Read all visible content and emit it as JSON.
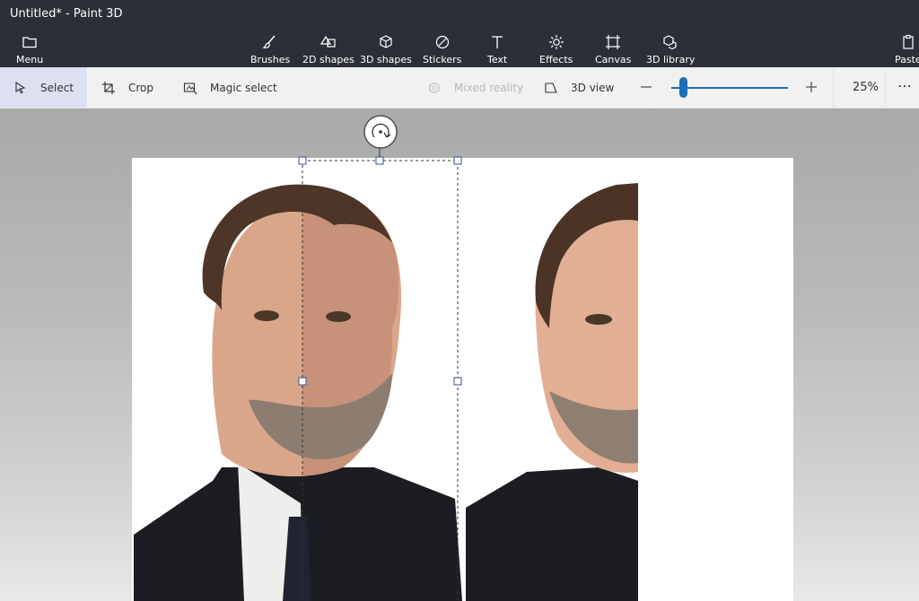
{
  "window": {
    "title": "Untitled* - Paint 3D"
  },
  "toolbar": {
    "menu": "Menu",
    "brushes": "Brushes",
    "shapes2d": "2D shapes",
    "shapes3d": "3D shapes",
    "stickers": "Stickers",
    "text": "Text",
    "effects": "Effects",
    "canvas": "Canvas",
    "library3d": "3D library",
    "paste": "Paste"
  },
  "subtoolbar": {
    "select": "Select",
    "crop": "Crop",
    "magic_select": "Magic select",
    "mixed_reality": "Mixed reality",
    "view_3d": "3D view",
    "zoom_level": "25%",
    "zoom_value": 0.1,
    "more": "⋯"
  },
  "colors": {
    "titlebar_bg": "#2b3038",
    "accent": "#1a6fb5",
    "select_active_bg": "#dde0f0"
  }
}
